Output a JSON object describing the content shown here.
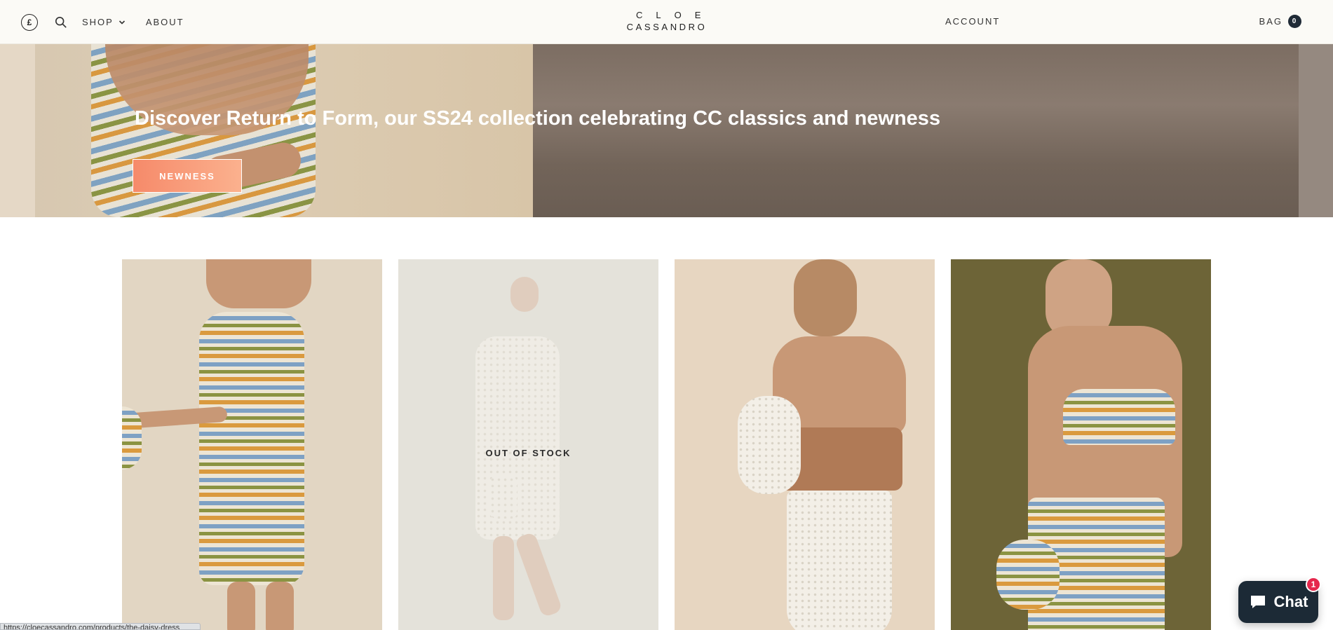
{
  "header": {
    "currency_symbol": "£",
    "nav": {
      "shop": "SHOP",
      "about": "ABOUT"
    },
    "logo": {
      "line1": "CLOE",
      "line2": "CASSANDRO"
    },
    "account": "ACCOUNT",
    "bag": {
      "label": "BAG",
      "count": "0"
    }
  },
  "hero": {
    "headline": "Discover Return to Form, our SS24 collection celebrating CC classics and newness",
    "cta": "NEWNESS"
  },
  "products": [
    {
      "status": ""
    },
    {
      "status": "OUT OF STOCK"
    },
    {
      "status": ""
    },
    {
      "status": ""
    }
  ],
  "chat": {
    "label": "Chat",
    "badge": "1"
  },
  "status_bar": {
    "url": "https://cloecassandro.com/products/the-daisy-dress"
  },
  "colors": {
    "header_bg": "#fbfaf6",
    "cta_bg": "#f68a6a",
    "chat_bg": "#1c2a36",
    "badge": "#e5274c"
  }
}
